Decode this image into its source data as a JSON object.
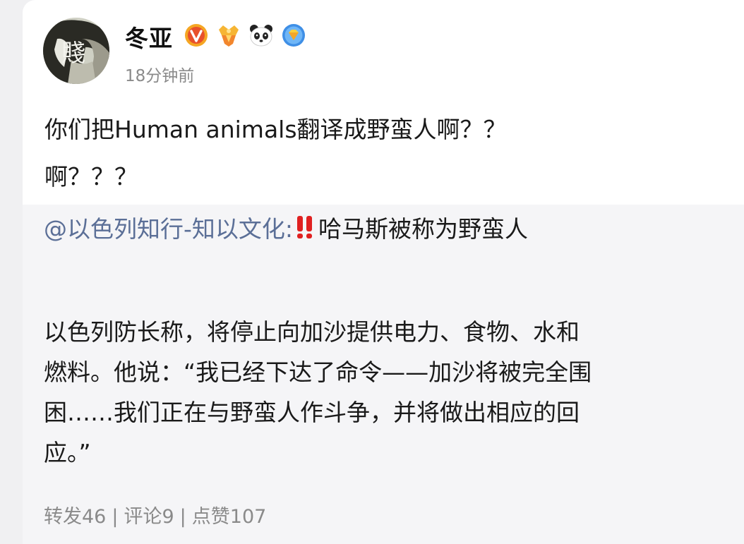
{
  "post": {
    "author": "冬亚",
    "time": "18分钟前",
    "badges": [
      "verified-v-badge",
      "gold-rank-badge",
      "panda-badge",
      "vip-diamond-badge"
    ],
    "text_lines": [
      "你们把Human animals翻译成野蛮人啊？？",
      "啊？？？"
    ]
  },
  "repost": {
    "mention": "@以色列知行-知以文化",
    "colon": ":",
    "alert_icon": "double-exclamation-icon",
    "headline": "哈马斯被称为野蛮人",
    "body_lines": [
      "以色列防长称，将停止向加沙提供电力、食物、水和",
      "燃料。他说：“我已经下达了命令——加沙将被完全围",
      "困……我们正在与野蛮人作斗争，并将做出相应的回",
      "应。”"
    ],
    "stats": {
      "reposts": "转发46",
      "comments": "评论9",
      "likes": "点赞107",
      "separator": "|"
    }
  },
  "colors": {
    "mention": "#5b6f97",
    "repost_bg": "#f5f5f7",
    "alert": "#e02020",
    "verified": "#f5a623"
  }
}
